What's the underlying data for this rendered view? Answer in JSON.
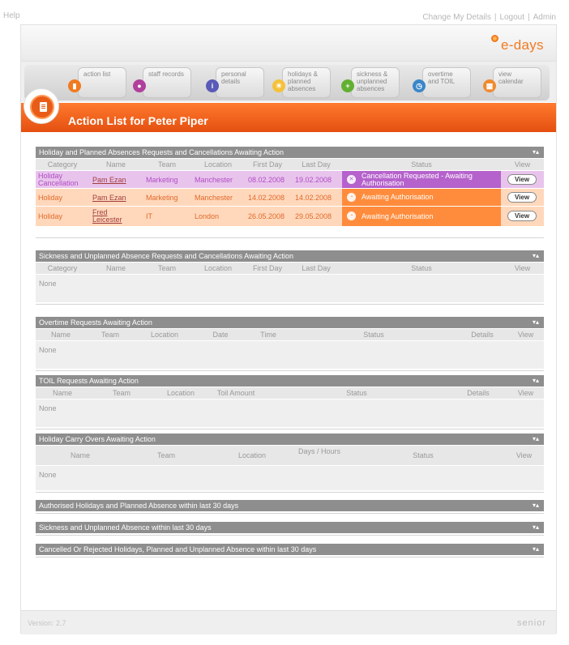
{
  "top": {
    "help": "Help",
    "links": [
      "Change My Details",
      "Logout",
      "Admin"
    ]
  },
  "brand": {
    "logo_text": "e-days"
  },
  "nav": [
    {
      "label": "action list",
      "icon": "action-list-icon",
      "color": "#f07a20"
    },
    {
      "label": "staff records",
      "icon": "staff-records-icon",
      "color": "#b0409c"
    },
    {
      "label": "personal details",
      "icon": "personal-details-icon",
      "color": "#5a5ab8"
    },
    {
      "label": "holidays & planned absences",
      "icon": "holidays-icon",
      "color": "#f5c13a"
    },
    {
      "label": "sickness & unplanned absences",
      "icon": "sickness-icon",
      "color": "#62b032"
    },
    {
      "label": "overtime and TOIL",
      "icon": "overtime-icon",
      "color": "#3a86c8"
    },
    {
      "label": "view calendar",
      "icon": "calendar-icon",
      "color": "#f08a30"
    }
  ],
  "page_title": "Action List for Peter Piper",
  "panels": {
    "holiday": {
      "title": "Holiday and Planned Absences Requests and Cancellations Awaiting Action",
      "columns": [
        "Category",
        "Name",
        "Team",
        "Location",
        "First Day",
        "Last Day",
        "Status",
        "View"
      ],
      "rows": [
        {
          "category": "Holiday Cancellation",
          "name": "Pam Ezan",
          "team": "Marketing",
          "location": "Manchester",
          "first": "08.02.2008",
          "last": "19.02.2008",
          "status": "Cancellation Requested - Awaiting Authorisation",
          "view": "View"
        },
        {
          "category": "Holiday",
          "name": "Pam Ezan",
          "team": "Marketing",
          "location": "Manchester",
          "first": "14.02.2008",
          "last": "14.02.2008",
          "status": "Awaiting Authorisation",
          "view": "View"
        },
        {
          "category": "Holiday",
          "name": "Fred Leicester",
          "team": "IT",
          "location": "London",
          "first": "26.05.2008",
          "last": "29.05.2008",
          "status": "Awaiting Authorisation",
          "view": "View"
        }
      ]
    },
    "sickness": {
      "title": "Sickness and Unplanned Absence Requests and Cancellations Awaiting Action",
      "columns": [
        "Category",
        "Name",
        "Team",
        "Location",
        "First Day",
        "Last Day",
        "Status",
        "View"
      ],
      "empty": "None"
    },
    "overtime": {
      "title": "Overtime Requests Awaiting Action",
      "columns": [
        "Name",
        "Team",
        "Location",
        "Date",
        "Time",
        "Status",
        "Details",
        "View"
      ],
      "empty": "None"
    },
    "toil": {
      "title": "TOIL Requests Awaiting Action",
      "columns": [
        "Name",
        "Team",
        "Location",
        "Toil Amount",
        "Status",
        "Details",
        "View"
      ],
      "empty": "None"
    },
    "carry": {
      "title": "Holiday Carry Overs Awaiting Action",
      "columns": [
        "Name",
        "Team",
        "Location",
        "Days / Hours",
        "Status",
        "View"
      ],
      "empty": "None"
    }
  },
  "collapsed": [
    "Authorised Holidays and Planned Absence within last 30 days",
    "Sickness and Unplanned Absence within last 30 days",
    "Cancelled Or Rejected Holidays, Planned and Unplanned Absence within last 30 days"
  ],
  "toggle_glyph": "▾▴",
  "colors": {
    "accent": "#e85c18",
    "cancel_row": "#e8c4ec",
    "cancel_status": "#b562cc",
    "await_row": "#ffd8bc",
    "await_status": "#ff8c3c"
  },
  "footer": {
    "version": "Version: 2.7",
    "brand": "senior"
  }
}
